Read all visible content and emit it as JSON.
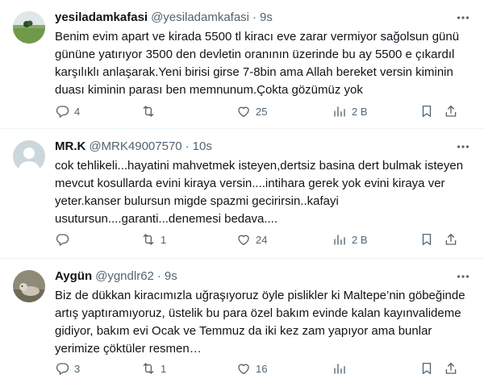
{
  "tweets": [
    {
      "name": "yesiladamkafasi",
      "handle": "@yesiladamkafasi",
      "separator": "·",
      "time": "9s",
      "text": "Benim evim apart ve kirada 5500 tl kiracı eve zarar vermiyor sağolsun günü gününe yatırıyor 3500 den devletin oranının üzerinde bu ay 5500 e çıkardıl karşılıklı anlaşarak.Yeni birisi girse 7-8bin ama Allah bereket versin kiminin duası kiminin parası ben memnunum.Çokta gözümüz yok",
      "replies": "4",
      "reposts": "",
      "likes": "25",
      "views": "2 B",
      "avatar_icon": "landscape-photo"
    },
    {
      "name": "MR.K",
      "handle": "@MRK49007570",
      "separator": "·",
      "time": "10s",
      "text": "cok tehlikeli...hayatini mahvetmek isteyen,dertsiz basina dert bulmak isteyen mevcut kosullarda evini kiraya versin....intihara gerek yok evini kiraya ver yeter.kanser bulursun migde spazmi gecirirsin..kafayi usutursun....garanti...denemesi bedava....",
      "replies": "",
      "reposts": "1",
      "likes": "24",
      "views": "2 B",
      "avatar_icon": "default-profile"
    },
    {
      "name": "Aygün",
      "handle": "@ygndlr62",
      "separator": "·",
      "time": "9s",
      "text": "Biz de dükkan kiracımızla uğraşıyoruz öyle pislikler ki Maltepe’nin göbeğinde artış yaptıramıyoruz, üstelik bu para özel bakım evinde kalan kayınvalideme gidiyor, bakım evi Ocak ve Temmuz da iki kez zam yapıyor ama bunlar yerimize çöktüler resmen…",
      "replies": "3",
      "reposts": "1",
      "likes": "16",
      "views": "",
      "avatar_icon": "dog-photo"
    }
  ],
  "colors": {
    "text": "#0f1419",
    "secondary": "#536471",
    "divider": "#eff3f4"
  },
  "icons": [
    "more-icon",
    "reply-icon",
    "repost-icon",
    "like-icon",
    "views-icon",
    "bookmark-icon",
    "share-icon"
  ]
}
